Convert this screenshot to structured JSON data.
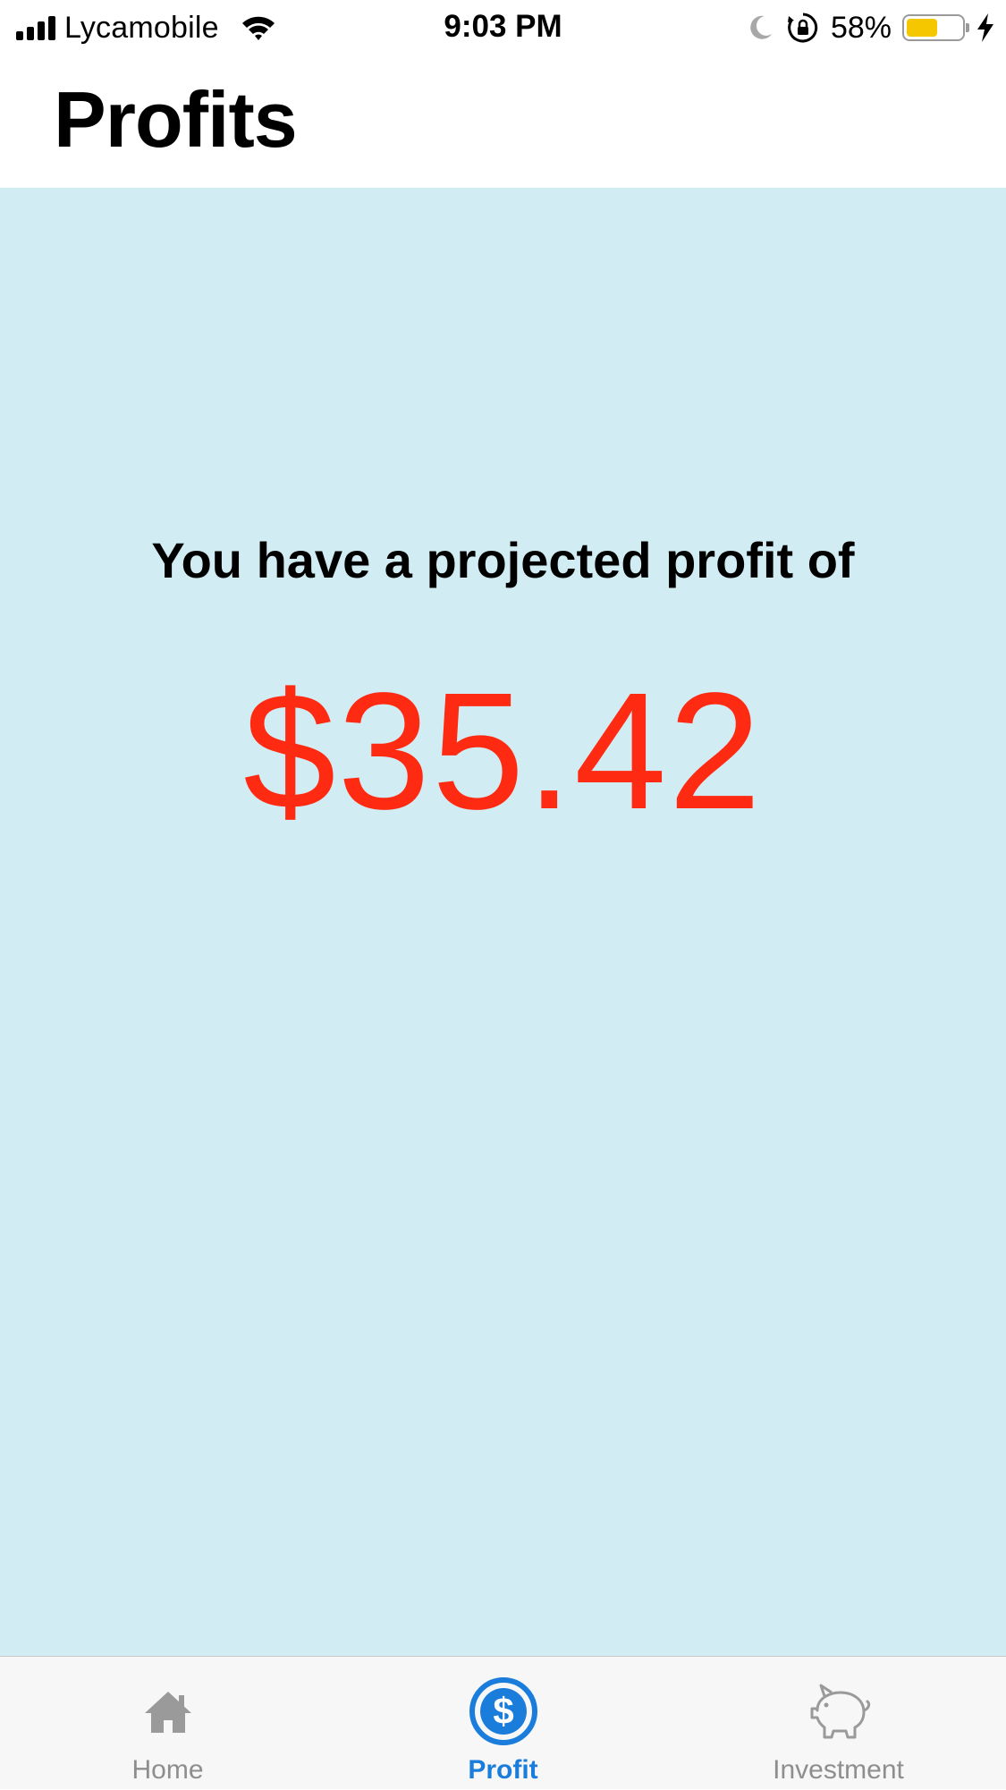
{
  "status_bar": {
    "carrier": "Lycamobile",
    "time": "9:03 PM",
    "battery_percent": "58%",
    "battery_level": 0.58,
    "signal_bars": 4
  },
  "header": {
    "title": "Profits"
  },
  "main": {
    "label": "You have a projected profit of",
    "profit": "$35.42"
  },
  "tab_bar": {
    "tabs": [
      {
        "label": "Home",
        "icon": "house-icon",
        "active": false
      },
      {
        "label": "Profit",
        "icon": "dollar-circle-icon",
        "active": true
      },
      {
        "label": "Investment",
        "icon": "piggy-bank-icon",
        "active": false
      }
    ]
  },
  "colors": {
    "background": "#d1ecf2",
    "profit": "#ff2a12",
    "active_tab": "#1a7cdb",
    "inactive_tab": "#8e8e8e",
    "battery_fill": "#f5c700"
  }
}
